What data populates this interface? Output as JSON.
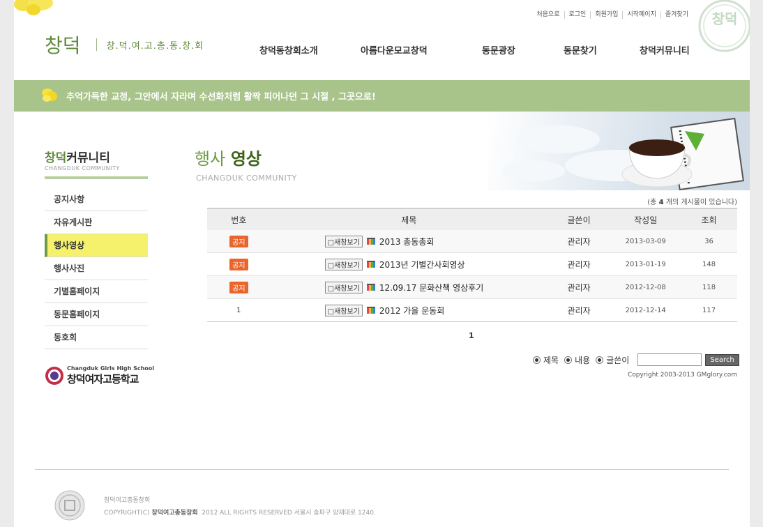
{
  "util_links": [
    "처음으로",
    "로그인",
    "회원가입",
    "시작페이지",
    "즐겨찾기"
  ],
  "logo": {
    "main": "창덕",
    "sub": "창.덕.여.고.총.동.창.회"
  },
  "seal_text": "창덕",
  "gnb": [
    "창덕동창회소개",
    "아름다운모교창덕",
    "동문광장",
    "동문찾기",
    "창덕커뮤니티"
  ],
  "banner_text": "추억가득한 교정, 그안에서 자라며 수선화처럼 활짝 피어나던 그 시절 , 그곳으로!",
  "sidebar": {
    "title_green": "창덕",
    "title_dark": "커뮤니티",
    "subtitle": "CHANGDUK COMMUNITY",
    "items": [
      "공지사항",
      "자유게시판",
      "행사영상",
      "행사사진",
      "기별홈페이지",
      "동문홈페이지",
      "동호회"
    ],
    "active": "행사영상",
    "school_en": "Changduk Girls High School",
    "school_ko": "창덕여자고등학교"
  },
  "page": {
    "title_light": "행사",
    "title_bold": "영상",
    "subtitle": "CHANGDUK COMMUNITY"
  },
  "board": {
    "count_prefix": "(총",
    "count": "4",
    "count_suffix": "개의 게시물이 있습니다)",
    "headers": [
      "번호",
      "제목",
      "글쓴이",
      "작성일",
      "조회"
    ],
    "new_window_label": "□새창보기",
    "notice_label": "공지",
    "rows": [
      {
        "no": "공지",
        "subject": "2013 총동총회",
        "author": "관리자",
        "date": "2013-03-09",
        "hits": "36"
      },
      {
        "no": "공지",
        "subject": "2013년 기별간사회영상",
        "author": "관리자",
        "date": "2013-01-19",
        "hits": "148"
      },
      {
        "no": "공지",
        "subject": "12.09.17 문화산책 영상후기",
        "author": "관리자",
        "date": "2012-12-08",
        "hits": "118"
      },
      {
        "no": "1",
        "subject": "2012 가을 운동회",
        "author": "관리자",
        "date": "2012-12-14",
        "hits": "117"
      }
    ]
  },
  "paging": {
    "current": "1"
  },
  "search": {
    "options": [
      "제목",
      "내용",
      "글쓴이"
    ],
    "input_value": "",
    "button": "Search"
  },
  "copyright": "Copyright 2003-2013 GMglory.com",
  "footer": {
    "org": "창덕여고총동창회",
    "copy_prefix": "COPYRIGHT(C)",
    "copy_org": "창덕여고총동창회",
    "copy_rest": "2012 ALL RIGHTS RESERVED 서울시 송파구 양재대로 1240."
  },
  "colors": {
    "accent_green": "#6e9a45",
    "banner_green": "#a8c48a",
    "active_yellow": "#f5f16c",
    "notice_orange": "#e8662e"
  }
}
